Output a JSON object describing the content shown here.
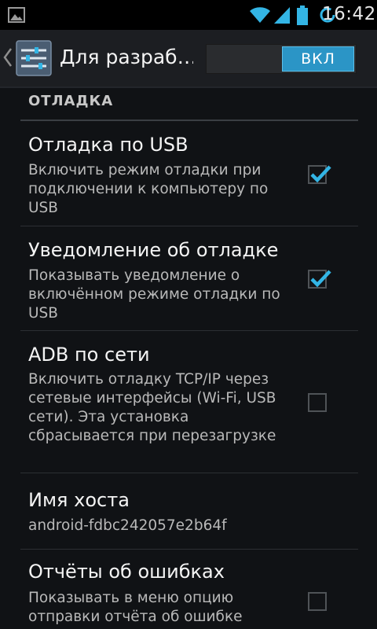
{
  "status_bar": {
    "time": "16:42",
    "icons": [
      "picture-icon",
      "wifi-icon",
      "signal-icon",
      "battery-icon",
      "sync-icon"
    ]
  },
  "action_bar": {
    "title": "Для разраб…",
    "up_icon": "chevron-left-icon",
    "app_icon": "settings-sliders-icon",
    "switch_label": "ВКЛ",
    "switch_on": true
  },
  "section": {
    "header": "ОТЛАДКА"
  },
  "prefs": [
    {
      "title": "Отладка по USB",
      "summary": "Включить режим отладки при подключении к компьютеру по USB",
      "checked": true
    },
    {
      "title": "Уведомление об отладке",
      "summary": "Показывать уведомление о включённом режиме отладки по USB",
      "checked": true
    },
    {
      "title": "ADB по сети",
      "summary": "Включить отладку TCP/IP через сетевые интерфейсы (Wi-Fi, USB сети). Эта установка сбрасывается при перезагрузке",
      "checked": false
    },
    {
      "title": "Имя хоста",
      "summary": "android-fdbc242057e2b64f"
    },
    {
      "title": "Отчёты об ошибках",
      "summary": "Показывать в меню опцию отправки отчёта об ошибке",
      "checked": false
    }
  ],
  "colors": {
    "accent": "#2b95c6",
    "check": "#33b5e5",
    "background": "#101215"
  }
}
